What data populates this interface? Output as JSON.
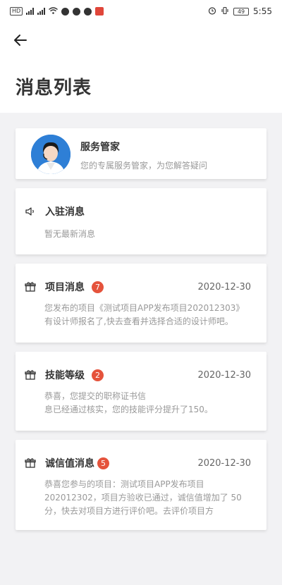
{
  "status_bar": {
    "hd_label": "HD",
    "signal1_label": "4G",
    "signal2_label": "3G",
    "battery_level": "49",
    "time": "5:55"
  },
  "header": {
    "title": "消息列表"
  },
  "service_card": {
    "title": "服务管家",
    "description": "您的专属服务管家，为您解答疑问"
  },
  "settle_card": {
    "title": "入驻消息",
    "body": "暂无最新消息"
  },
  "messages": [
    {
      "title": "项目消息",
      "badge": "7",
      "date": "2020-12-30",
      "body_lines": [
        "您发布的项目《测试项目APP发布项目202012303》",
        "有设计师报名了,快去查看并选择合适的设计师吧。"
      ]
    },
    {
      "title": "技能等级",
      "badge": "2",
      "date": "2020-12-30",
      "body_lines": [
        "恭喜，您提交的职称证书信",
        "息已经通过核实，您的技能评分提升了150。"
      ]
    },
    {
      "title": "诚信值消息",
      "badge": "5",
      "date": "2020-12-30",
      "body_lines": [
        "恭喜您参与的项目：测试项目APP发布项目",
        "202012302，项目方验收已通过，诚信值增加了 50",
        "分，快去对项目方进行评价吧。去评价项目方"
      ]
    }
  ],
  "icons": {
    "back": "arrow-left-icon",
    "speaker": "speaker-icon",
    "gift": "gift-icon"
  },
  "colors": {
    "badge": "#e5533c",
    "avatar_bg": "#2e7fd6",
    "page_bg": "#f2f2f4"
  }
}
